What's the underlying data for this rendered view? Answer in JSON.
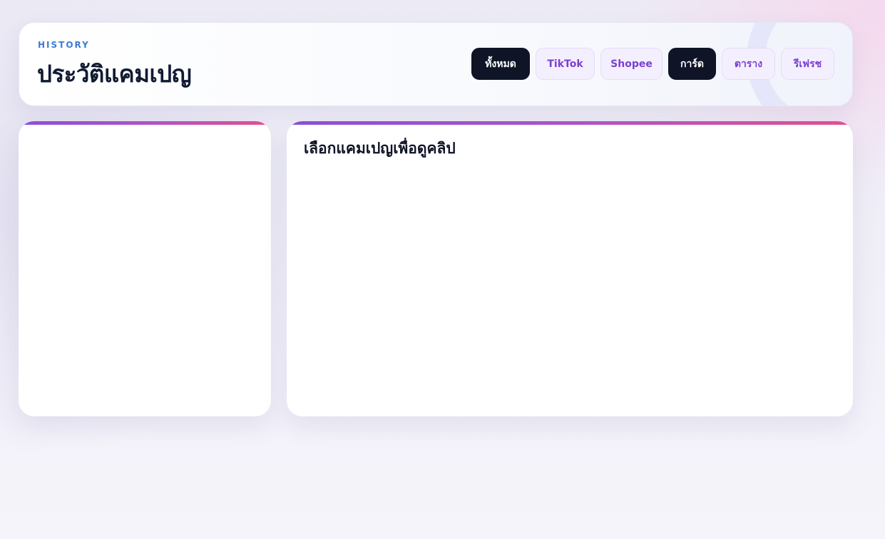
{
  "header": {
    "eyebrow": "HISTORY",
    "title": "ประวัติแคมเปญ",
    "filters": [
      {
        "label": "ทั้งหมด",
        "active": true
      },
      {
        "label": "TikTok",
        "active": false
      },
      {
        "label": "Shopee",
        "active": false
      },
      {
        "label": "การ์ด",
        "active": true
      },
      {
        "label": "ตาราง",
        "active": false
      },
      {
        "label": "รีเฟรช",
        "active": false
      }
    ]
  },
  "detail": {
    "placeholder": "เลือกแคมเปญเพื่อดูคลิป"
  },
  "colors": {
    "accent_start": "#8a4fd8",
    "accent_end": "#e2508f",
    "active_chip": "#0f1426",
    "chip_text": "#7c3fd0",
    "eyebrow": "#3d7bd6",
    "title": "#101a33"
  }
}
